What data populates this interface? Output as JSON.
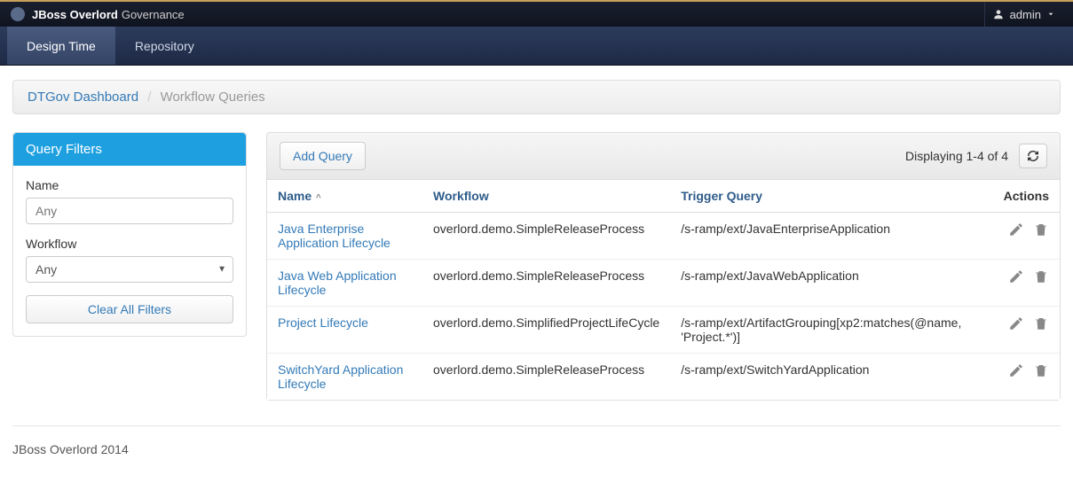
{
  "header": {
    "brand_strong": "JBoss Overlord",
    "brand_sub": "Governance",
    "user": "admin"
  },
  "nav": {
    "tabs": [
      {
        "label": "Design Time",
        "active": true
      },
      {
        "label": "Repository",
        "active": false
      }
    ]
  },
  "breadcrumb": {
    "root": "DTGov Dashboard",
    "sep": "/",
    "current": "Workflow Queries"
  },
  "filters": {
    "title": "Query Filters",
    "name_label": "Name",
    "name_placeholder": "Any",
    "workflow_label": "Workflow",
    "workflow_value": "Any",
    "clear_label": "Clear All Filters"
  },
  "toolbar": {
    "add_label": "Add Query",
    "display_text": "Displaying 1-4 of 4"
  },
  "table": {
    "headers": {
      "name": "Name",
      "workflow": "Workflow",
      "trigger": "Trigger Query",
      "actions": "Actions"
    },
    "rows": [
      {
        "name": "Java Enterprise Application Lifecycle",
        "workflow": "overlord.demo.SimpleReleaseProcess",
        "trigger": "/s-ramp/ext/JavaEnterpriseApplication"
      },
      {
        "name": "Java Web Application Lifecycle",
        "workflow": "overlord.demo.SimpleReleaseProcess",
        "trigger": "/s-ramp/ext/JavaWebApplication"
      },
      {
        "name": "Project Lifecycle",
        "workflow": "overlord.demo.SimplifiedProjectLifeCycle",
        "trigger": "/s-ramp/ext/ArtifactGrouping[xp2:matches(@name, 'Project.*')]"
      },
      {
        "name": "SwitchYard Application Lifecycle",
        "workflow": "overlord.demo.SimpleReleaseProcess",
        "trigger": "/s-ramp/ext/SwitchYardApplication"
      }
    ]
  },
  "footer": {
    "text": "JBoss Overlord 2014"
  }
}
